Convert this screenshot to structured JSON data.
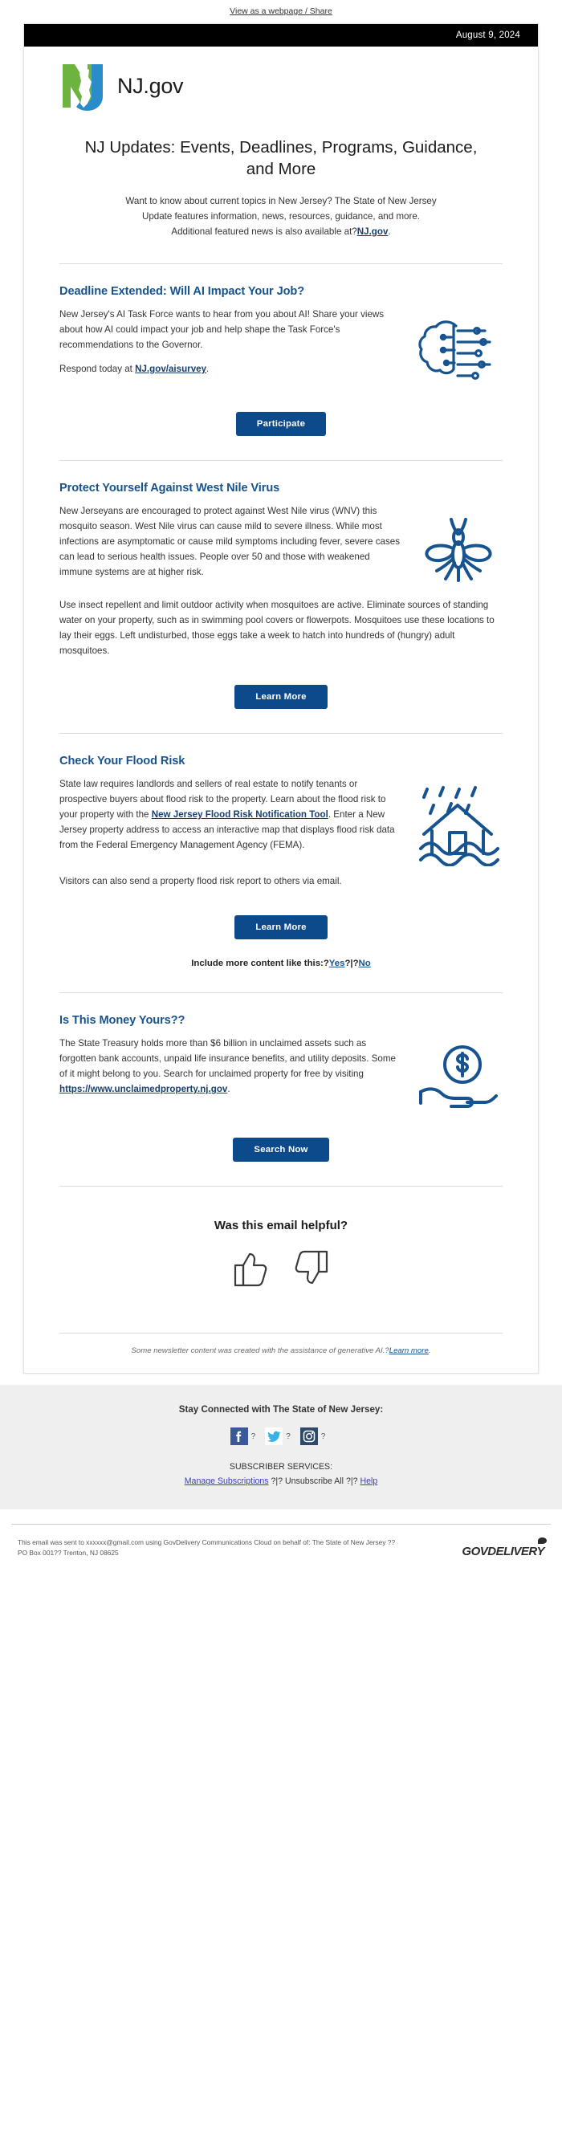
{
  "preheader": {
    "text": "View as a webpage / Share"
  },
  "header": {
    "date": "August 9, 2024",
    "logo_word": "NJ.gov",
    "logo_icon": "nj-state-logo",
    "title": "NJ Updates: Events, Deadlines, Programs, Guidance, and More"
  },
  "intro": {
    "line1": "Want to know about current topics in New Jersey? The State of New Jersey",
    "line2": "Update features information, news, resources, guidance, and more.",
    "line3_pre": "Additional featured news is also available at?",
    "link": "NJ.gov",
    "line3_post": "."
  },
  "articles": [
    {
      "id": "ai-job-survey",
      "heading": "Deadline Extended: Will AI Impact Your Job?",
      "icon": "brain-circuit-icon",
      "paragraph": "New Jersey's AI Task Force wants to hear from you about AI! Share your views about how AI could impact your job and help shape the Task Force's recommendations to the Governor.",
      "cta_pre": "Respond today at ",
      "cta_link": "NJ.gov/aisurvey",
      "cta_post": ".",
      "button": "Participate"
    },
    {
      "id": "west-nile-virus",
      "heading": "Protect Yourself Against West Nile Virus",
      "icon": "mosquito-icon",
      "paragraph": "New Jerseyans are encouraged to protect against West Nile virus (WNV) this mosquito season. West Nile virus can cause mild to severe illness. While most infections are asymptomatic or cause mild symptoms including fever, severe cases can lead to serious health issues. People over 50 and those with weakened immune systems are at higher risk.",
      "paragraph2": "Use insect repellent and limit outdoor activity when mosquitoes are active. Eliminate sources of standing water on your property, such as in swimming pool covers or flowerpots. Mosquitoes use these locations to lay their eggs. Left undisturbed, those eggs take a week to hatch into hundreds of (hungry) adult mosquitoes.",
      "button": "Learn More"
    },
    {
      "id": "flood-risk",
      "heading": "Check Your Flood Risk",
      "icon": "flooded-house-icon",
      "para_pre": "State law requires landlords and sellers of real estate to notify tenants or prospective buyers about flood risk to the property. Learn about the flood risk to your property with the ",
      "para_link": "New Jersey Flood Risk Notification Tool",
      "para_post": ". Enter a New Jersey property address to access an interactive map that displays flood risk data from the Federal Emergency Management Agency (FEMA).",
      "paragraph2": "Visitors can also send a property flood risk report to others via email.",
      "button": "Learn More",
      "feedback_label": "Include more content like this:?",
      "feedback_yes": "Yes",
      "feedback_sep": "?|?",
      "feedback_no": "No"
    },
    {
      "id": "unclaimed-money",
      "heading": "Is This Money Yours??",
      "icon": "hand-holding-dollar-icon",
      "para_pre": "The State Treasury holds more than $6 billion in unclaimed assets such as forgotten bank accounts, unpaid life insurance benefits, and utility deposits. Some of it might belong to you. Search for unclaimed property for free by visiting ",
      "para_link": "https://www.unclaimedproperty.nj.gov",
      "para_post": ".",
      "button": "Search Now"
    }
  ],
  "helpful": {
    "question": "Was this email helpful?",
    "thumbs_up_icon": "thumbs-up-icon",
    "thumbs_down_icon": "thumbs-down-icon"
  },
  "ai_note": {
    "text": "Some newsletter content was created with the assistance of generative AI.?",
    "link": "Learn more",
    "post": "."
  },
  "footer": {
    "stay_connected": "Stay Connected with The State of New Jersey:",
    "social": [
      {
        "name": "facebook-icon",
        "label": "f",
        "color": "#3b5998",
        "sep": "?"
      },
      {
        "name": "twitter-icon",
        "label": "t",
        "color": "#38b0e8",
        "sep": "?"
      },
      {
        "name": "instagram-icon",
        "label": "ig",
        "color": "#2e4a6b",
        "sep": "?"
      }
    ],
    "subscriber_services": "SUBSCRIBER SERVICES:",
    "manage": "Manage Subscriptions",
    "sep1": " ?|? ",
    "unsubscribe": "Unsubscribe All",
    "sep2": " ?|? ",
    "help": "Help",
    "legal_line1": "This email was sent to xxxxxx@gmail.com using GovDelivery Communications Cloud on behalf of: The State of New Jersey ??",
    "legal_line2": "PO Box 001?? Trenton, NJ 08625",
    "gd_logo": "GOVDELIVERY"
  },
  "colors": {
    "heading_blue": "#17538c",
    "button_blue": "#0d4a8c",
    "link_blue": "#18406e",
    "logo_green": "#6cb33f",
    "logo_blue": "#2b8cca",
    "icon_blue": "#16538f",
    "datebar_bg": "#000000",
    "footer_bg": "#efefef"
  }
}
